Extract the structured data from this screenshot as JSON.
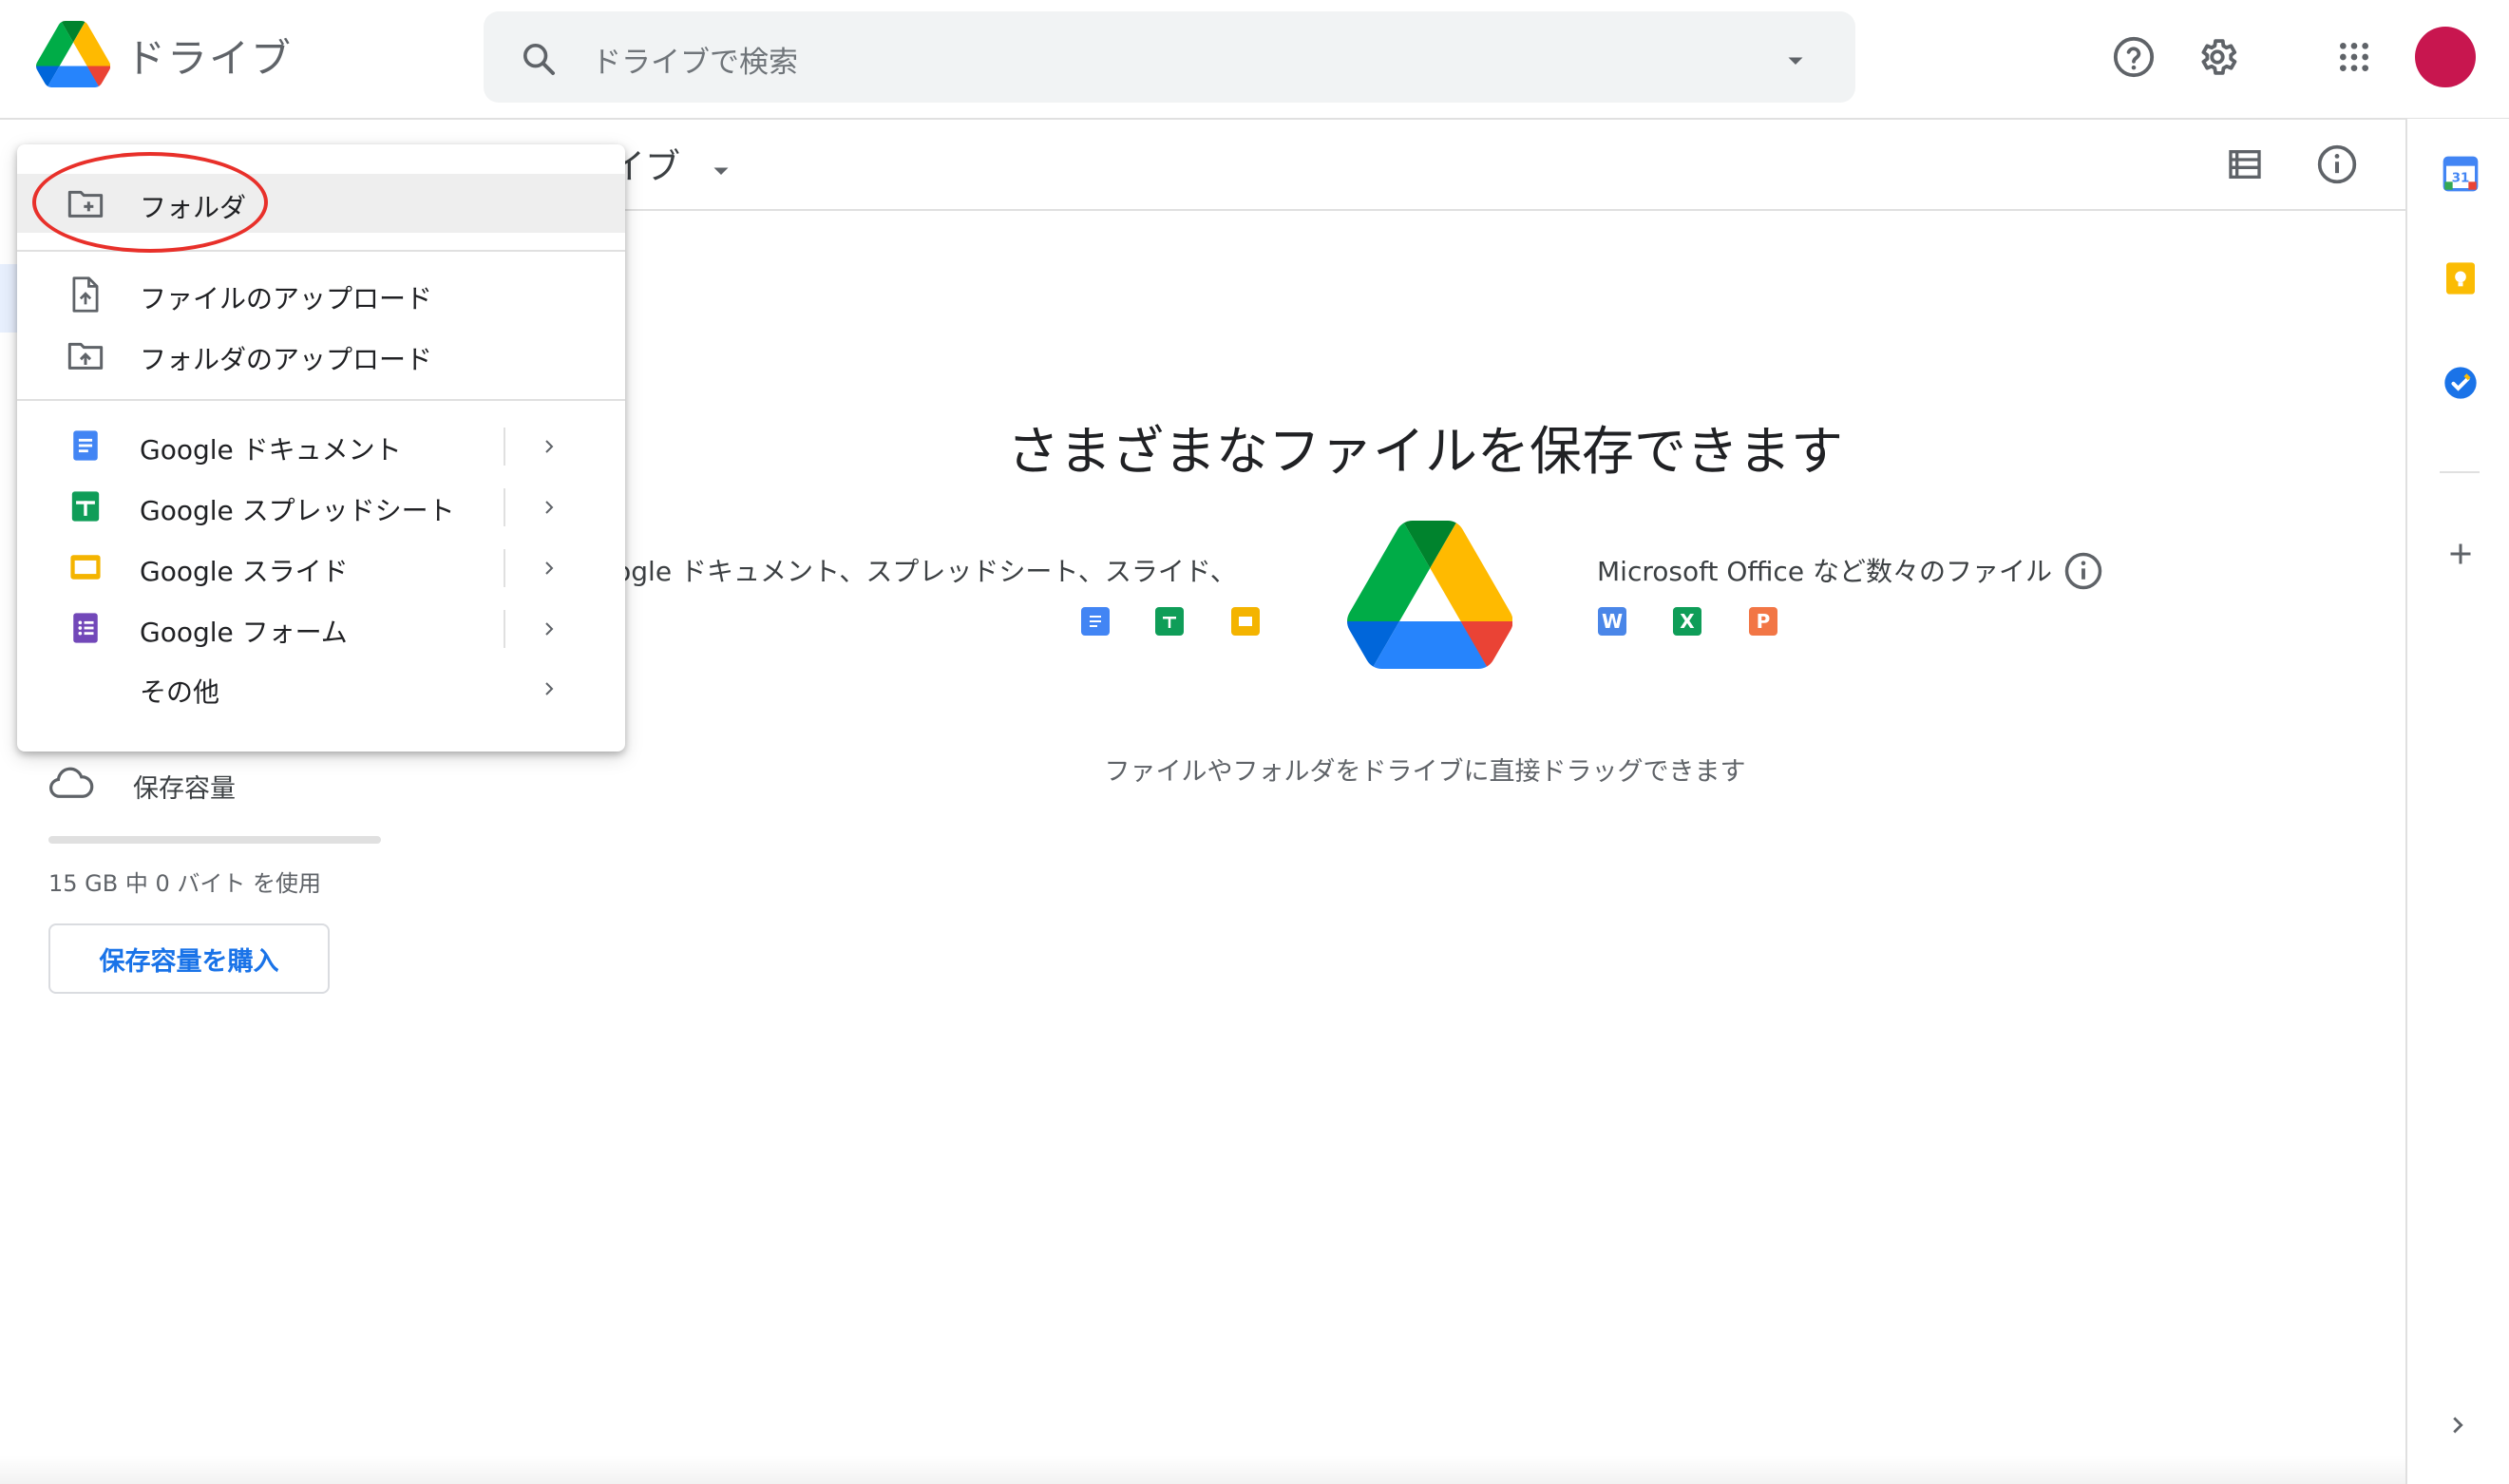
{
  "header": {
    "app_name": "ドライブ",
    "search_placeholder": "ドライブで検索"
  },
  "toolbar": {
    "breadcrumb": "イブ"
  },
  "new_menu": {
    "items": [
      {
        "label": "フォルダ",
        "icon": "new-folder-icon"
      },
      {
        "label": "ファイルのアップロード",
        "icon": "file-upload-icon"
      },
      {
        "label": "フォルダのアップロード",
        "icon": "folder-upload-icon"
      },
      {
        "label": "Google ドキュメント",
        "icon": "google-docs-icon"
      },
      {
        "label": "Google スプレッドシート",
        "icon": "google-sheets-icon"
      },
      {
        "label": "Google スライド",
        "icon": "google-slides-icon"
      },
      {
        "label": "Google フォーム",
        "icon": "google-forms-icon"
      },
      {
        "label": "その他",
        "icon": ""
      }
    ]
  },
  "sidebar": {
    "storage_label": "保存容量",
    "storage_usage": "15 GB 中 0 バイト を使用",
    "storage_used_fraction": 0.0,
    "buy_storage_label": "保存容量を購入"
  },
  "main": {
    "empty_title": "さまざまなファイルを保存できます",
    "left_caption": "oogle ドキュメント、スプレッドシート、スライド、",
    "right_caption": "Microsoft Office など数々のファイル",
    "drag_caption": "ファイルやフォルダをドライブに直接ドラッグできます",
    "office_icons": [
      "W",
      "X",
      "P"
    ]
  },
  "side_panel": {
    "calendar_day": "31"
  },
  "colors": {
    "accent_blue": "#1a73e8",
    "docs_blue": "#4285f4",
    "sheets_green": "#0f9d58",
    "slides_yellow": "#f4b400",
    "forms_purple": "#7248b9",
    "avatar": "#c8164f",
    "annotation_red": "#e8302a"
  }
}
